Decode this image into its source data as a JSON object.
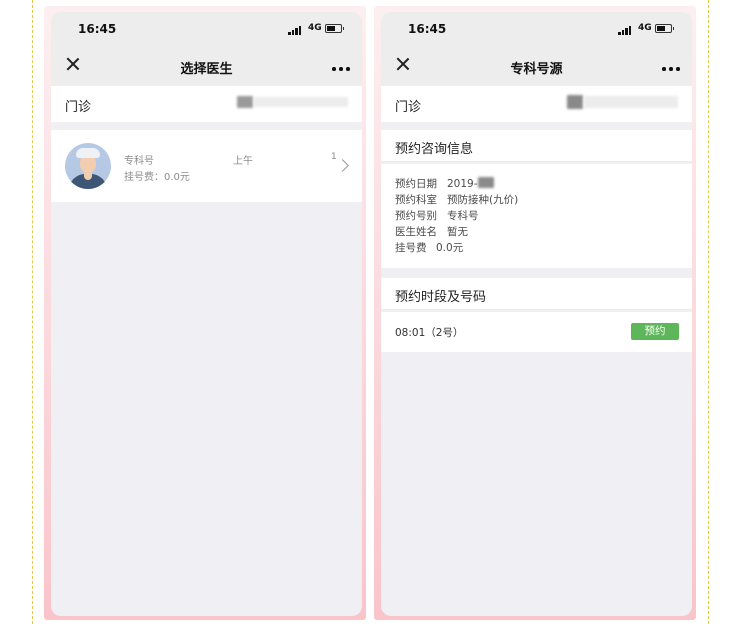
{
  "status_bar": {
    "time": "16:45",
    "network": "4G"
  },
  "left_screen": {
    "nav": {
      "title": "选择医生"
    },
    "department_label": "门诊",
    "doctor": {
      "type": "专科号",
      "period": "上午",
      "count": "1",
      "fee_text": "挂号费：0.0元"
    }
  },
  "right_screen": {
    "nav": {
      "title": "专科号源"
    },
    "department_label": "门诊",
    "info_title": "预约咨询信息",
    "info": [
      {
        "key": "预约日期",
        "value": "2019-"
      },
      {
        "key": "预约科室",
        "value": "预防接种(九价)"
      },
      {
        "key": "预约号别",
        "value": "专科号"
      },
      {
        "key": "医生姓名",
        "value": "暂无"
      },
      {
        "key": "挂号费",
        "value": "0.0元"
      }
    ],
    "slots_title": "预约时段及号码",
    "slot": {
      "time": "08:01（2号）",
      "button_label": "预约"
    }
  },
  "colors": {
    "accent_green": "#5eb65a",
    "frame_pink": "#f9c4ca",
    "nav_gray": "#ededed"
  }
}
